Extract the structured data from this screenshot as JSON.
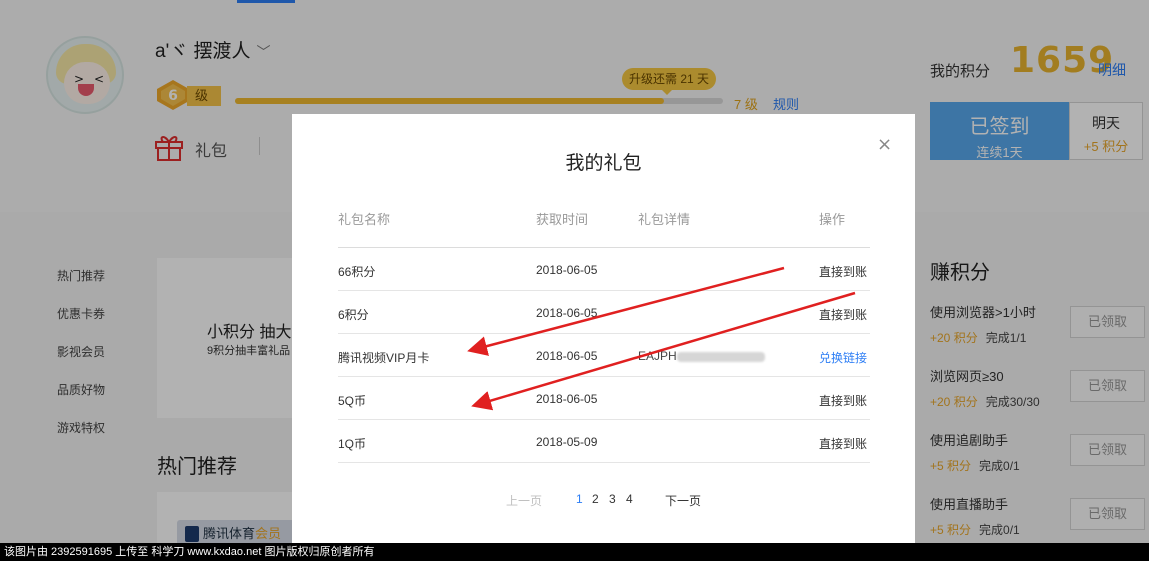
{
  "user": {
    "name": "a'ヾ 摆渡人",
    "level": "6",
    "level_suffix": "级"
  },
  "progress": {
    "tip": "升级还需 21 天",
    "fraction": 0.88,
    "next_level": "7 级",
    "rules": "规则"
  },
  "tabs": {
    "gift": "礼包"
  },
  "points": {
    "label": "我的积分",
    "value": "1659",
    "detail": "明细"
  },
  "checkin": {
    "title": "已签到",
    "streak": "连续1天",
    "tomorrow_label": "明天",
    "tomorrow_bonus": "+5 积分"
  },
  "side_nav": [
    "热门推荐",
    "优惠卡券",
    "影视会员",
    "品质好物",
    "游戏特权"
  ],
  "promo": {
    "title": "小积分 抽大",
    "sub": "9积分抽丰富礼品"
  },
  "hot": {
    "title": "热门推荐",
    "banner_prefix": "腾讯体育",
    "banner_accent": "会员"
  },
  "earn": {
    "title": "赚积分",
    "tasks": [
      {
        "name": "使用浏览器>1小时",
        "points": "+20 积分",
        "progress": "完成1/1",
        "button": "已领取"
      },
      {
        "name": "浏览网页≥30",
        "points": "+20 积分",
        "progress": "完成30/30",
        "button": "已领取"
      },
      {
        "name": "使用追剧助手",
        "points": "+5 积分",
        "progress": "完成0/1",
        "button": "已领取"
      },
      {
        "name": "使用直播助手",
        "points": "+5 积分",
        "progress": "完成0/1",
        "button": "已领取"
      }
    ]
  },
  "modal": {
    "title": "我的礼包",
    "close": "×",
    "headers": [
      "礼包名称",
      "获取时间",
      "礼包详情",
      "操作"
    ],
    "rows": [
      {
        "name": "66积分",
        "date": "2018-06-05",
        "detail": "",
        "action": "直接到账"
      },
      {
        "name": "6积分",
        "date": "2018-06-05",
        "detail": "",
        "action": "直接到账"
      },
      {
        "name": "腾讯视频VIP月卡",
        "date": "2018-06-05",
        "detail": "EAJPH",
        "action": "兑换链接"
      },
      {
        "name": "5Q币",
        "date": "2018-06-05",
        "detail": "",
        "action": "直接到账"
      },
      {
        "name": "1Q币",
        "date": "2018-05-09",
        "detail": "",
        "action": "直接到账"
      }
    ],
    "pager": {
      "prev": "上一页",
      "pages": [
        "1",
        "2",
        "3",
        "4"
      ],
      "current": "1",
      "next": "下一页"
    }
  },
  "watermark": "该图片由 2392591695 上传至 科学刀 www.kxdao.net 图片版权归原创者所有",
  "colors": {
    "accent_blue": "#2d7ef5",
    "gold": "#e9b42e",
    "checkin_blue": "#58a8ec",
    "arrow_red": "#e02020"
  }
}
